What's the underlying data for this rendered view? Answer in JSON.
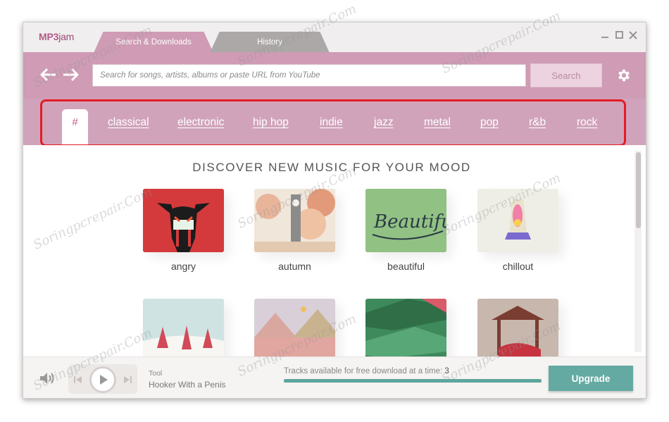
{
  "app": {
    "logo_prefix": "MP3",
    "logo_suffix": "jam"
  },
  "tabs": [
    {
      "label": "Search & Downloads",
      "active": true
    },
    {
      "label": "History",
      "active": false
    }
  ],
  "toolbar": {
    "search_placeholder": "Search for songs, artists, albums or paste URL from YouTube",
    "search_label": "Search"
  },
  "genres": {
    "hash": "#",
    "items": [
      "classical",
      "electronic",
      "hip hop",
      "indie",
      "jazz",
      "metal",
      "pop",
      "r&b",
      "rock"
    ]
  },
  "content": {
    "heading": "DISCOVER NEW MUSIC FOR YOUR MOOD",
    "moods": [
      {
        "label": "angry"
      },
      {
        "label": "autumn"
      },
      {
        "label": "beautiful"
      },
      {
        "label": "chillout"
      },
      {
        "label": ""
      },
      {
        "label": ""
      },
      {
        "label": ""
      },
      {
        "label": ""
      }
    ],
    "beautiful_art_text": "Beautiful"
  },
  "player": {
    "artist": "Tool",
    "title": "Hooker With a Penis",
    "free_text": "Tracks available for free download at a time:",
    "free_count": "3",
    "free_fraction": 1.0,
    "upgrade_label": "Upgrade"
  },
  "watermark": "Soringpcrepair.Com",
  "colors": {
    "accent": "#cf9bb5",
    "genre_bar": "#d1a3bb",
    "upgrade": "#64aaa2",
    "highlight": "#e31c25"
  }
}
